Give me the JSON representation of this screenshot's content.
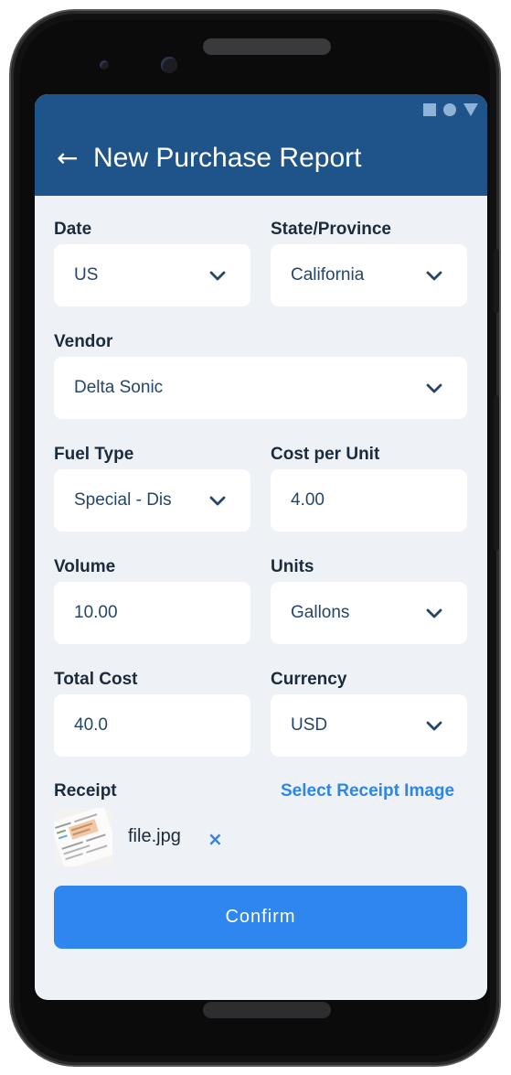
{
  "appbar": {
    "title": "New Purchase Report",
    "back_icon": "←"
  },
  "form": {
    "date": {
      "label": "Date",
      "value": "US"
    },
    "state": {
      "label": "State/Province",
      "value": "California"
    },
    "vendor": {
      "label": "Vendor",
      "value": "Delta Sonic"
    },
    "fuel_type": {
      "label": "Fuel Type",
      "value": "Special - Dis"
    },
    "cost_per_unit": {
      "label": "Cost per Unit",
      "value": "4.00"
    },
    "volume": {
      "label": "Volume",
      "value": "10.00"
    },
    "units": {
      "label": "Units",
      "value": "Gallons"
    },
    "total_cost": {
      "label": "Total Cost",
      "value": "40.0"
    },
    "currency": {
      "label": "Currency",
      "value": "USD"
    }
  },
  "receipt": {
    "label": "Receipt",
    "select_link": "Select Receipt Image",
    "file_name": "file.jpg",
    "remove_icon": "×"
  },
  "confirm_label": "Confirm",
  "colors": {
    "appbar": "#1f548a",
    "accent": "#2f86ee",
    "background": "#eef2f6",
    "field_text": "#25466a"
  },
  "icons": [
    "arrow-left-icon",
    "chevron-down-icon",
    "close-icon",
    "receipt-thumbnail"
  ]
}
